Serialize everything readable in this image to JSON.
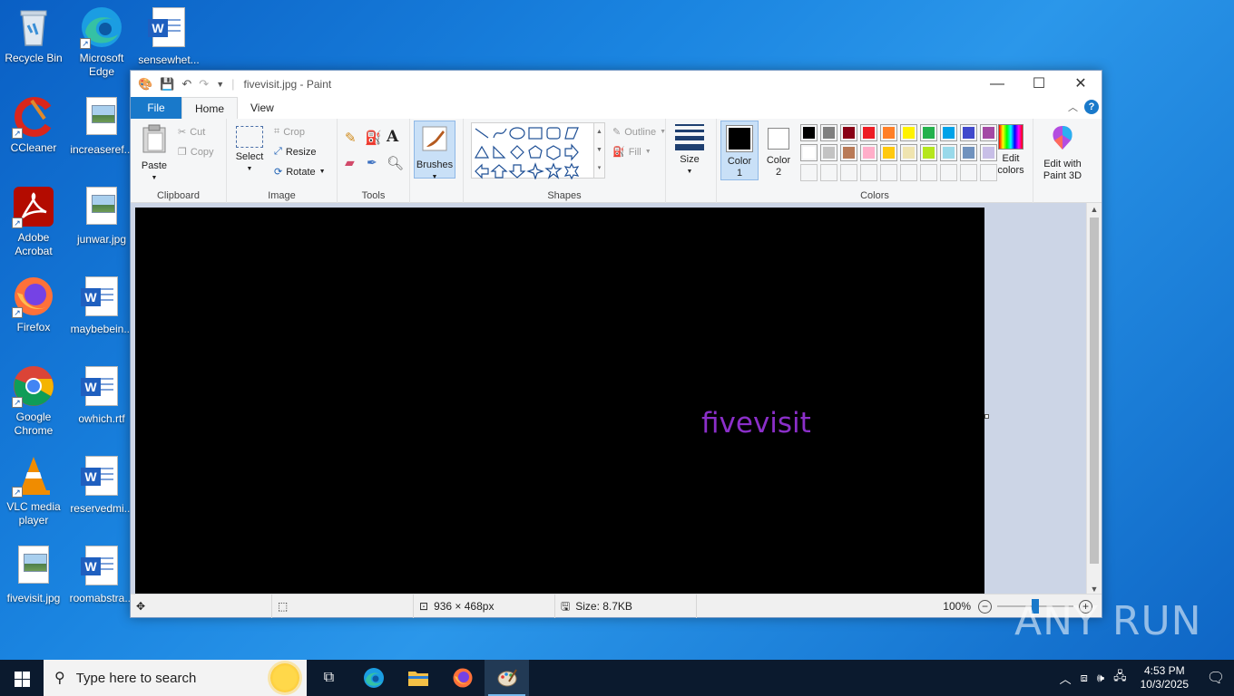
{
  "desktop": {
    "icons": [
      {
        "label": "Recycle Bin"
      },
      {
        "label": "Microsoft Edge"
      },
      {
        "label": "sensewhet..."
      },
      {
        "label": "CCleaner"
      },
      {
        "label": "increaseref..."
      },
      {
        "label": "Adobe Acrobat"
      },
      {
        "label": "junwar.jpg"
      },
      {
        "label": "Firefox"
      },
      {
        "label": "maybebein..."
      },
      {
        "label": "Google Chrome"
      },
      {
        "label": "owhich.rtf"
      },
      {
        "label": "VLC media player"
      },
      {
        "label": "reservedmi..."
      },
      {
        "label": "fivevisit.jpg"
      },
      {
        "label": "roomabstra..."
      }
    ],
    "watermark": "ANY RUN"
  },
  "window": {
    "title": "fivevisit.jpg - Paint",
    "controls": {
      "minimize": "—",
      "maximize": "☐",
      "close": "✕"
    }
  },
  "ribbon_tabs": {
    "file": "File",
    "home": "Home",
    "view": "View",
    "help": "?"
  },
  "ribbon": {
    "clipboard": {
      "paste": "Paste",
      "cut": "Cut",
      "copy": "Copy",
      "label": "Clipboard"
    },
    "image": {
      "select": "Select",
      "crop": "Crop",
      "resize": "Resize",
      "rotate": "Rotate",
      "label": "Image"
    },
    "tools": {
      "label": "Tools"
    },
    "brushes": {
      "label": "Brushes"
    },
    "shapes": {
      "outline": "Outline",
      "fill": "Fill",
      "label": "Shapes"
    },
    "size": {
      "label": "Size"
    },
    "colors": {
      "color1": "Color",
      "color1_num": "1",
      "color2": "Color",
      "color2_num": "2",
      "edit_colors": "Edit",
      "edit_colors_2": "colors",
      "edit_3d": "Edit with",
      "edit_3d_2": "Paint 3D",
      "label": "Colors",
      "palette_row1": [
        "#000000",
        "#7f7f7f",
        "#880015",
        "#ed1c24",
        "#ff7f27",
        "#fff200",
        "#22b14c",
        "#00a2e8",
        "#3f48cc",
        "#a349a4"
      ],
      "palette_row2": [
        "#ffffff",
        "#c3c3c3",
        "#b97a57",
        "#ffaec9",
        "#ffc90e",
        "#efe4b0",
        "#b5e61d",
        "#99d9ea",
        "#7092be",
        "#c8bfe7"
      ],
      "color1_value": "#000000",
      "color2_value": "#ffffff"
    }
  },
  "canvas": {
    "text": "fivevisit",
    "text_color": "#8b2fc9"
  },
  "statusbar": {
    "dimensions": "936 × 468px",
    "size": "Size: 8.7KB",
    "zoom": "100%"
  },
  "taskbar": {
    "search_placeholder": "Type here to search",
    "time": "4:53 PM",
    "date": "10/3/2025"
  }
}
